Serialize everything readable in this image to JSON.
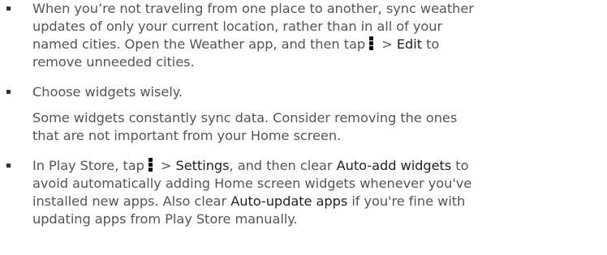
{
  "items": [
    {
      "lines": [
        "When you’re not traveling from one place to another, sync weather",
        "updates of only your current location, rather than in all of your",
        "named cities. Open the Weather app, and then tap"
      ],
      "line3_mid": " > ",
      "line3_bold": "Edit",
      "line3_after": " to",
      "line4": "remove unneeded cities.",
      "icon": "more-vertical-icon"
    },
    {
      "heading": "Choose widgets wisely.",
      "body_lines": [
        "Some widgets constantly sync data. Consider removing the ones",
        "that are not important from your Home screen."
      ]
    },
    {
      "line1_before": "In Play Store, tap",
      "line1_mid": " > ",
      "line1_bold1": "Settings",
      "line1_after1": ", and then clear ",
      "line1_bold2": "Auto-add widgets",
      "line1_after2": " to",
      "line2": "avoid automatically adding Home screen widgets whenever you've",
      "line3_before": "installed new apps. Also clear ",
      "line3_bold": "Auto-update apps",
      "line3_after": " if you're fine with",
      "line4": "updating apps from Play Store manually.",
      "icon": "more-vertical-icon"
    }
  ]
}
